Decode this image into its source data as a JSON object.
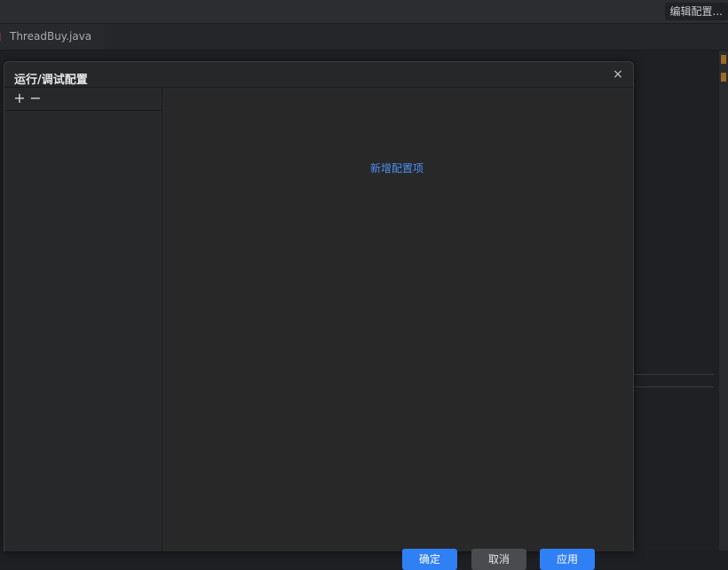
{
  "ide": {
    "edit_config_label": "编辑配置...",
    "file_tab_label": "ThreadBuy.java"
  },
  "dialog": {
    "title": "运行/调试配置",
    "close_glyph": "×",
    "add_glyph": "+",
    "remove_glyph": "−",
    "add_config_link": "新增配置项",
    "buttons": {
      "ok": "确定",
      "cancel": "取消",
      "apply": "应用"
    }
  },
  "colors": {
    "accent": "#2f7ff5",
    "link": "#4d8ff0"
  }
}
